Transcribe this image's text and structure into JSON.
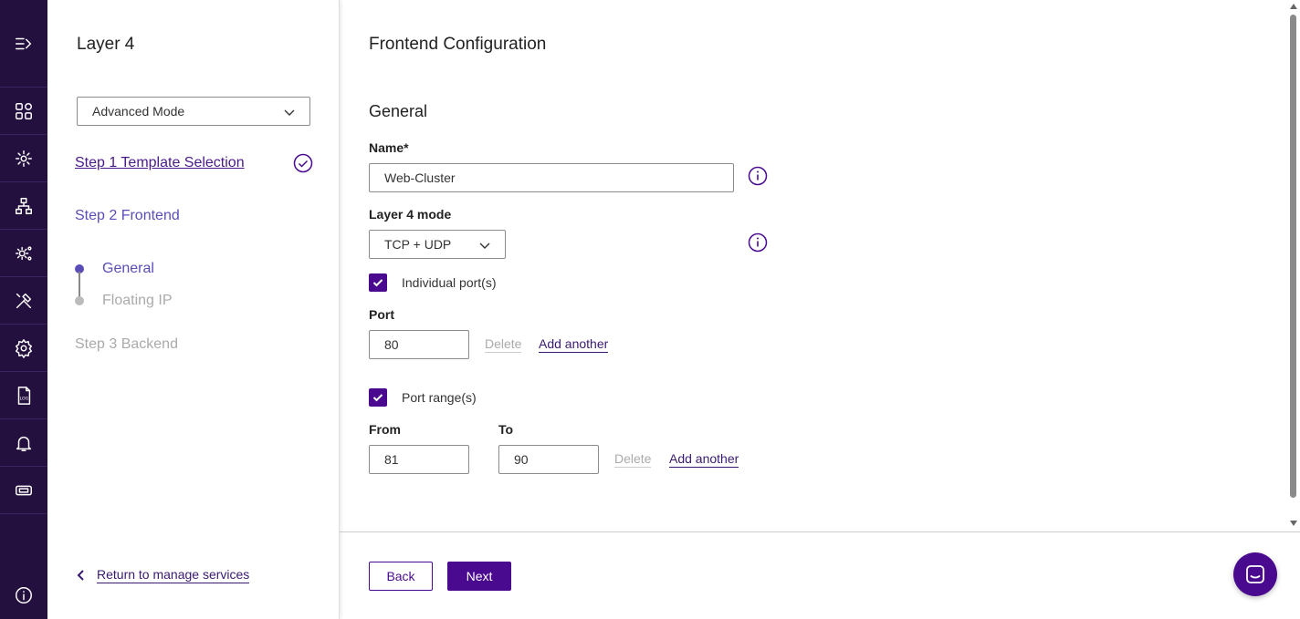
{
  "colors": {
    "rail_bg": "#24103f",
    "primary": "#4a0a8f",
    "active_step": "#5a4db8",
    "muted": "#aaaaaa"
  },
  "rail": {
    "icons": [
      "expand-menu-icon",
      "dashboard-icon",
      "services-icon",
      "network-icon",
      "cluster-settings-icon",
      "tools-icon",
      "settings-icon",
      "log-icon",
      "notifications-icon",
      "ticket-icon",
      "info-icon"
    ],
    "log_text": "LOG"
  },
  "panel": {
    "title": "Layer 4",
    "mode_select": "Advanced Mode",
    "step1": "Step 1 Template Selection",
    "step2": "Step 2 Frontend",
    "sub_general": "General",
    "sub_floating_ip": "Floating IP",
    "step3": "Step 3 Backend",
    "return_link": "Return to manage services"
  },
  "main": {
    "title": "Frontend Configuration",
    "section": "General",
    "name_label": "Name*",
    "name_value": "Web-Cluster",
    "mode_label": "Layer 4 mode",
    "mode_value": "TCP + UDP",
    "individual_ports_label": "Individual port(s)",
    "individual_ports_checked": true,
    "port_label": "Port",
    "port_value": "80",
    "delete_label": "Delete",
    "add_another_label": "Add another",
    "port_range_label": "Port range(s)",
    "port_range_checked": true,
    "from_label": "From",
    "from_value": "81",
    "to_label": "To",
    "to_value": "90"
  },
  "footer": {
    "back_label": "Back",
    "next_label": "Next"
  }
}
